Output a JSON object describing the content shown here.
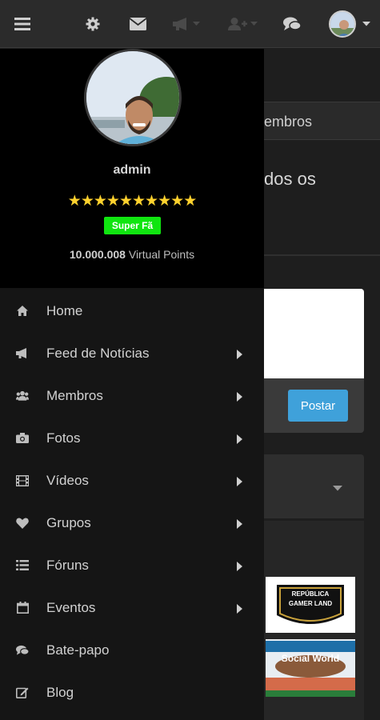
{
  "topbar": {
    "icons": [
      "menu-icon",
      "gear-icon",
      "envelope-icon",
      "megaphone-icon",
      "add-user-icon",
      "chat-bubbles-icon",
      "user-avatar"
    ]
  },
  "background": {
    "tab_label": "embros",
    "heading": "dos os",
    "post_button": "Postar",
    "thumb1_text": "REPÚBLICA GAMER LAND",
    "thumb2_text": "Social World"
  },
  "profile": {
    "username": "admin",
    "star_count": 10,
    "rank_badge": "Super Fã",
    "points_value": "10.000.008",
    "points_label": "Virtual Points"
  },
  "menu": {
    "items": [
      {
        "label": "Home",
        "icon": "home-icon",
        "has_submenu": false
      },
      {
        "label": "Feed de Notícias",
        "icon": "megaphone-icon",
        "has_submenu": true
      },
      {
        "label": "Membros",
        "icon": "users-icon",
        "has_submenu": true
      },
      {
        "label": "Fotos",
        "icon": "camera-icon",
        "has_submenu": true
      },
      {
        "label": "Vídeos",
        "icon": "film-icon",
        "has_submenu": true
      },
      {
        "label": "Grupos",
        "icon": "heart-icon",
        "has_submenu": true
      },
      {
        "label": "Fóruns",
        "icon": "list-icon",
        "has_submenu": true
      },
      {
        "label": "Eventos",
        "icon": "calendar-icon",
        "has_submenu": true
      },
      {
        "label": "Bate-papo",
        "icon": "chat-bubbles-icon",
        "has_submenu": false
      },
      {
        "label": "Blog",
        "icon": "edit-icon",
        "has_submenu": false
      }
    ]
  },
  "colors": {
    "accent_button": "#3fa1da",
    "badge": "#10e510",
    "star": "#ffd22e",
    "topbar": "#2b2b2b",
    "drawer": "#151515"
  }
}
